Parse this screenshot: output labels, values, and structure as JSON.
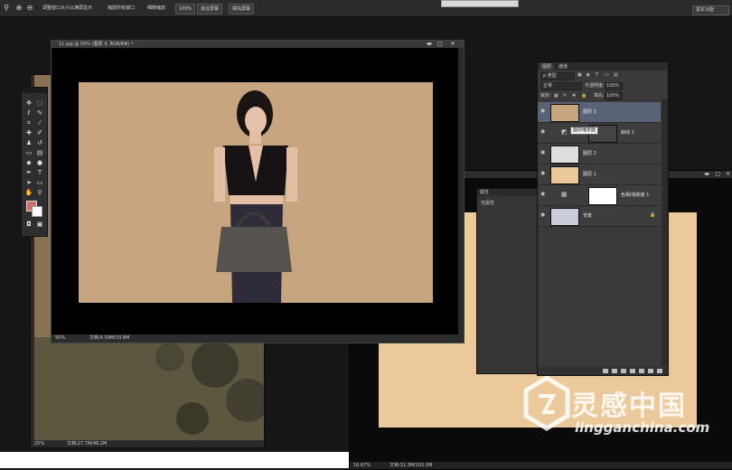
{
  "options_bar": {
    "items": [
      "调整窗口大小以满屏显示",
      "缩放所有窗口",
      "细微缩放",
      "100%",
      "适合屏幕",
      "填充屏幕"
    ],
    "workspace": "基本功能"
  },
  "main_doc": {
    "title": "11.jpg @ 50% (图层 3, RGB/8#) *",
    "zoom": "50%",
    "status": "文档:6.59M/33.8M"
  },
  "left_doc": {
    "zoom": "25%",
    "status": "文档:27.7M/46.2M"
  },
  "right_doc": {
    "zoom": "16.67%",
    "status": "文档:31.3M/102.0M"
  },
  "properties": {
    "tab": "属性",
    "content": "无属性"
  },
  "layers": {
    "tabs": [
      "图层",
      "通道"
    ],
    "kind_label": "ρ 类型",
    "blend_mode": "正常",
    "opacity_label": "不透明度:",
    "opacity_value": "100%",
    "lock_label": "锁定:",
    "fill_label": "填充:",
    "fill_value": "100%",
    "tooltip": "图层缩览图",
    "rows": [
      {
        "name": "图层 3",
        "selected": true
      },
      {
        "name": "曲线 1",
        "selected": false
      },
      {
        "name": "图层 2",
        "selected": false
      },
      {
        "name": "图层 1",
        "selected": false
      },
      {
        "name": "色相/饱和度 1",
        "selected": false
      },
      {
        "name": "背景",
        "selected": false
      }
    ]
  },
  "watermark": {
    "title": "灵感中国",
    "url": "lingganchina.com"
  }
}
